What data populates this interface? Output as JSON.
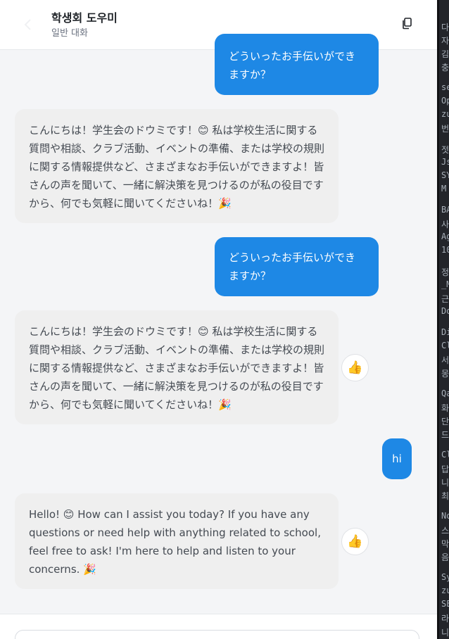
{
  "header": {
    "title": "학생회 도우미",
    "subtitle": "일반 대화"
  },
  "messages": [
    {
      "role": "user",
      "text": "どういったお手伝いができますか？"
    },
    {
      "role": "assistant",
      "text": "こんにちは！学生会のドウミです！😊 私は学校生活に関する質問や相談、クラブ活動、イベントの準備、または学校の規則に関する情報提供など、さまざまなお手伝いができますよ！皆さんの声を聞いて、一緒に解決策を見つけるのが私の役目ですから、何でも気軽に聞いてくださいね！🎉"
    },
    {
      "role": "user",
      "text": "どういったお手伝いができますか？"
    },
    {
      "role": "assistant",
      "text": "こんにちは！学生会のドウミです！😊 私は学校生活に関する質問や相談、クラブ活動、イベントの準備、または学校の規則に関する情報提供など、さまざまなお手伝いができますよ！皆さんの声を聞いて、一緒に解決策を見つけるのが私の役目ですから、何でも気軽に聞いてくださいね！🎉",
      "reaction": "👍"
    },
    {
      "role": "user",
      "text": "hi"
    },
    {
      "role": "assistant",
      "text": "Hello! 😊 How can I assist you today? If you have any questions or need help with anything related to school, feel free to ask! I'm here to help and listen to your concerns. 🎉",
      "reaction": "👍"
    }
  ],
  "colors": {
    "user_bubble": "#1e88e5",
    "bot_bubble": "#efefef",
    "background": "#f4f5f7"
  },
  "icons": {
    "back": "back-icon",
    "copy": "copy-icon",
    "reaction": "thumbs-up-icon"
  },
  "side_panel": {
    "lines": [
      "다",
      "자",
      "김",
      "충",
      "se",
      "Op",
      "zu",
      "번",
      "젓",
      "Js",
      "SY",
      "M",
      "BA",
      "사",
      "Ag",
      "10",
      "정",
      "_M",
      "근",
      "Do",
      "Di",
      "Cl",
      "서",
      "몽",
      "Qa",
      "화",
      "단",
      "드",
      "Cl",
      "답",
      "니",
      "최",
      "No",
      "스",
      "막",
      "음",
      "Sy",
      "zu",
      "SE",
      "라",
      "니"
    ]
  }
}
